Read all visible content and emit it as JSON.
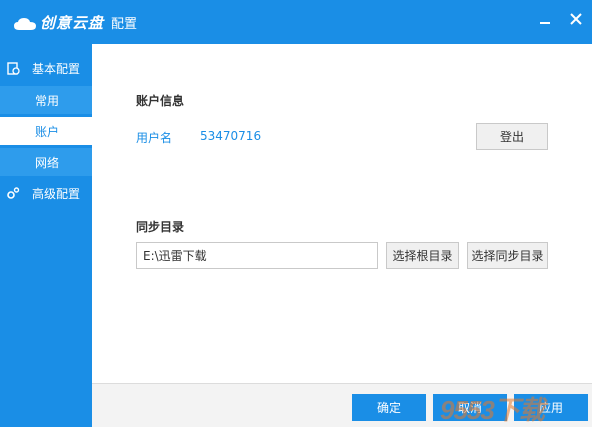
{
  "app": {
    "logo_text": "创意云盘",
    "window_title": "配置"
  },
  "sidebar": {
    "groups": [
      {
        "label": "基本配置",
        "icon": "settings-doc-icon"
      },
      {
        "label": "高级配置",
        "icon": "gears-icon"
      }
    ],
    "items": [
      {
        "label": "常用",
        "active": false
      },
      {
        "label": "账户",
        "active": true
      },
      {
        "label": "网络",
        "active": false
      }
    ]
  },
  "account": {
    "section_title": "账户信息",
    "username_label": "用户名",
    "username_value": "53470716",
    "login_button": "登出"
  },
  "sync": {
    "section_title": "同步目录",
    "path_value": "E:\\迅雷下载",
    "select_root_button": "选择根目录",
    "select_sync_button": "选择同步目录"
  },
  "footer": {
    "ok_button": "确定",
    "cancel_button": "取消",
    "apply_button": "应用"
  },
  "watermark": {
    "text": "9553下载"
  },
  "colors": {
    "accent": "#1a8ee6",
    "sidebar_sub": "#2e9cec",
    "footer_bg": "#f3f3f3"
  }
}
